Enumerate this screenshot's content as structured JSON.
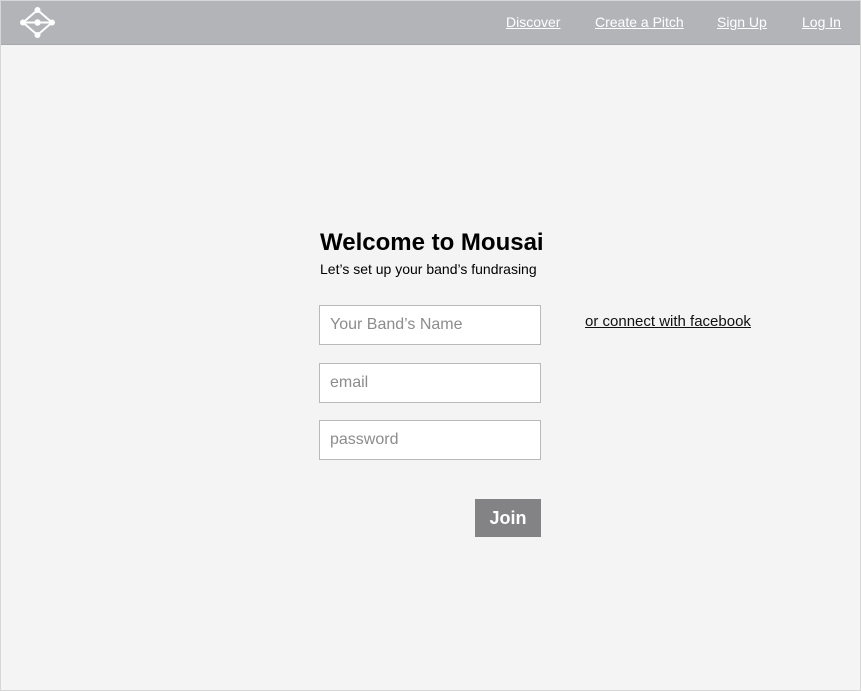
{
  "header": {
    "logo_icon": "network-nodes-icon",
    "nav": {
      "discover": "Discover",
      "create_pitch": "Create a Pitch",
      "sign_up": "Sign Up",
      "log_in": "Log In"
    }
  },
  "main": {
    "title": "Welcome to Mousai",
    "subtitle": "Let’s set up your band’s fundrasing",
    "form": {
      "band_name_placeholder": "Your Band’s Name",
      "email_placeholder": "email",
      "password_placeholder": "password",
      "join_label": "Join"
    },
    "facebook_link": "or connect with facebook"
  },
  "colors": {
    "navbar": "#b3b4b8",
    "background": "#f4f4f4",
    "button": "#838385"
  }
}
